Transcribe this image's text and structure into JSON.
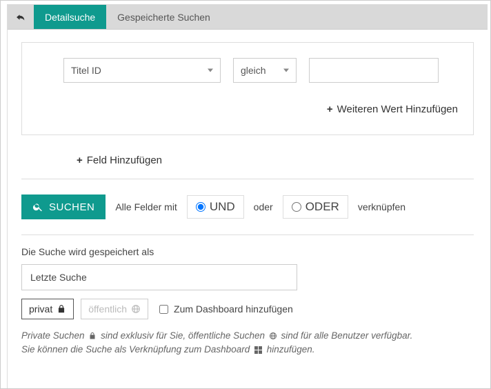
{
  "tabs": {
    "detail": "Detailsuche",
    "saved": "Gespeicherte Suchen"
  },
  "search_box": {
    "field_select": "Titel ID",
    "operator_select": "gleich",
    "value": "",
    "add_value": "Weiteren Wert Hinzufügen",
    "add_field": "Feld Hinzufügen"
  },
  "search_bar": {
    "button": "SUCHEN",
    "prefix": "Alle Felder mit",
    "and": "UND",
    "middle": "oder",
    "or": "ODER",
    "suffix": "verknüpfen"
  },
  "save": {
    "heading": "Die Suche wird gespeichert als",
    "name_value": "Letzte Suche",
    "private": "privat",
    "public": "öffentlich",
    "dashboard": "Zum Dashboard hinzufügen"
  },
  "info": {
    "l1a": "Private Suchen",
    "l1b": "sind exklusiv für Sie, öffentliche Suchen",
    "l1c": "sind für alle Benutzer verfügbar.",
    "l2a": "Sie können die Suche als Verknüpfung zum Dashboard",
    "l2b": "hinzufügen."
  }
}
